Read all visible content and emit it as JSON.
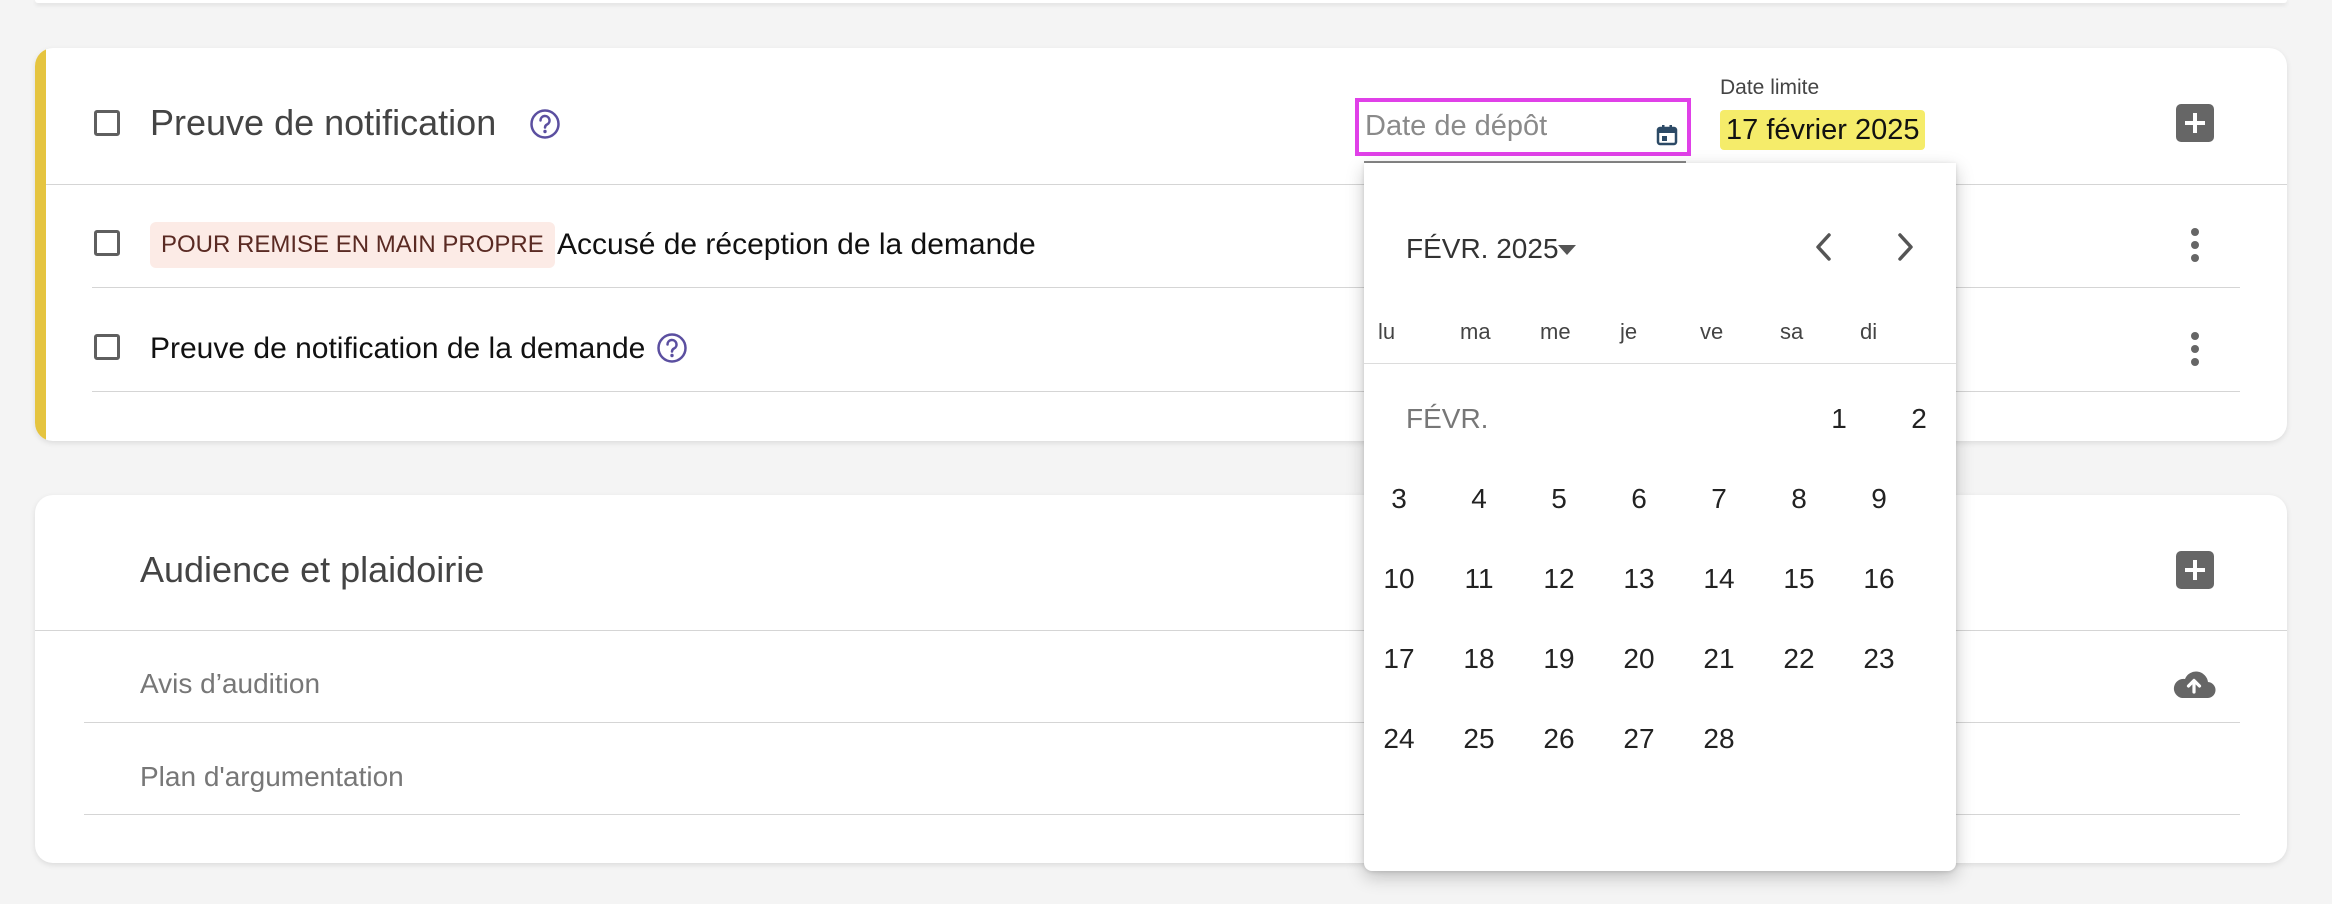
{
  "section1": {
    "title": "Preuve de notification",
    "date_input": {
      "placeholder": "Date de dépôt"
    },
    "deadline": {
      "label": "Date limite",
      "value": "17 février 2025"
    },
    "rows": [
      {
        "chip": "POUR REMISE EN MAIN PROPRE",
        "label": "Accusé de réception de la demande"
      },
      {
        "label": "Preuve de notification de la demande"
      }
    ]
  },
  "section2": {
    "title": "Audience et plaidoirie",
    "items": [
      "Avis d’audition",
      "Plan d'argumentation"
    ]
  },
  "datepicker": {
    "month_year": "FÉVR. 2025",
    "month_label": "FÉVR.",
    "weekdays": [
      "lu",
      "ma",
      "me",
      "je",
      "ve",
      "sa",
      "di"
    ],
    "days": [
      "1",
      "2",
      "3",
      "4",
      "5",
      "6",
      "7",
      "8",
      "9",
      "10",
      "11",
      "12",
      "13",
      "14",
      "15",
      "16",
      "17",
      "18",
      "19",
      "20",
      "21",
      "22",
      "23",
      "24",
      "25",
      "26",
      "27",
      "28"
    ]
  },
  "colors": {
    "accent": "#e5c43f",
    "focus_outline": "#e040e8",
    "deadline_highlight": "#f5ec6a",
    "chip_bg": "#fcebe6",
    "help_icon": "#5b4fa0",
    "calendar_icon": "#2c4a66"
  },
  "icons": {
    "help": "question-circle-icon",
    "calendar": "calendar-icon",
    "add": "plus-square-icon",
    "menu": "kebab-vertical-icon",
    "upload": "cloud-upload-icon",
    "prev": "chevron-left-icon",
    "next": "chevron-right-icon",
    "dropdown": "caret-down-icon"
  }
}
